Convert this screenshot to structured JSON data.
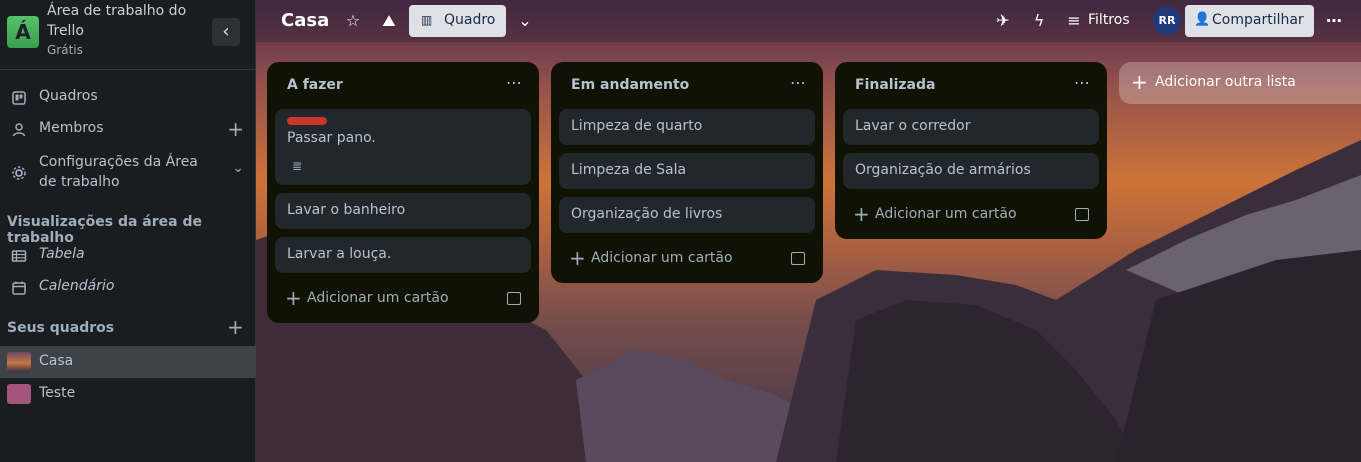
{
  "workspace": {
    "logo_letter": "Á",
    "name": "Área de trabalho do Trello",
    "plan": "Grátis"
  },
  "sidebar": {
    "items": [
      {
        "label": "Quadros"
      },
      {
        "label": "Membros"
      },
      {
        "label": "Configurações da Área de trabalho"
      }
    ],
    "views_title": "Visualizações da área de trabalho",
    "views": [
      {
        "label": "Tabela"
      },
      {
        "label": "Calendário"
      }
    ],
    "boards_title": "Seus quadros",
    "boards": [
      {
        "label": "Casa",
        "color": "#7a4e5e"
      },
      {
        "label": "Teste",
        "color": "#a4557c"
      }
    ]
  },
  "topbar": {
    "board_title": "Casa",
    "view_label": "Quadro",
    "filters_label": "Filtros",
    "avatar_initials": "RR",
    "share_label": "Compartilhar"
  },
  "lists": [
    {
      "title": "A fazer",
      "cards": [
        "Passar pano.",
        "Lavar o banheiro",
        "Larvar a louça."
      ],
      "add_card_label": "Adicionar um cartão"
    },
    {
      "title": "Em andamento",
      "cards": [
        "Limpeza de quarto",
        "Limpeza de Sala",
        "Organização de livros"
      ],
      "add_card_label": "Adicionar um cartão"
    },
    {
      "title": "Finalizada",
      "cards": [
        "Lavar o corredor",
        "Organização de armários"
      ],
      "add_card_label": "Adicionar um cartão"
    }
  ],
  "add_list_label": "Adicionar outra lista",
  "colors": {
    "label_red": "#c9372c",
    "list_bg": "#101204",
    "card_bg": "#22272b"
  }
}
